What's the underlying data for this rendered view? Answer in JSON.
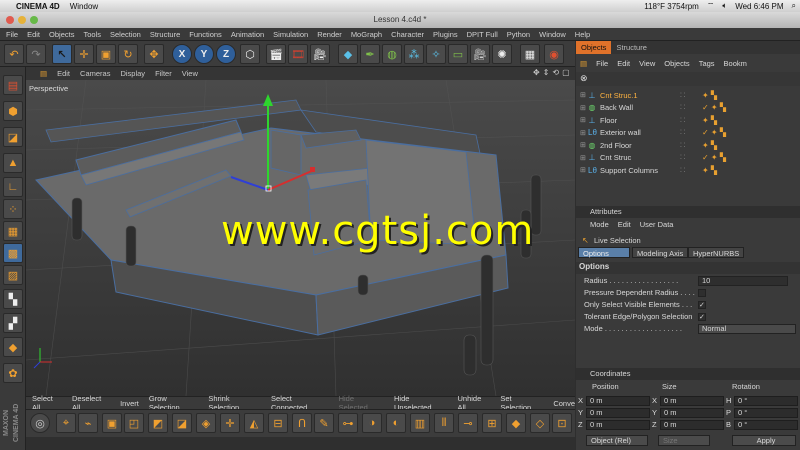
{
  "mac": {
    "app_name": "CINEMA 4D",
    "menu_window": "Window",
    "status": "118°F 3754rpm",
    "clock": "Wed 6:46 PM"
  },
  "window_title": "Lesson 4.c4d *",
  "menubar": [
    "File",
    "Edit",
    "Objects",
    "Tools",
    "Selection",
    "Structure",
    "Functions",
    "Animation",
    "Simulation",
    "Render",
    "MoGraph",
    "Character",
    "Plugins",
    "DPIT Full",
    "Python",
    "Window",
    "Help"
  ],
  "axis_buttons": [
    "X",
    "Y",
    "Z"
  ],
  "viewport": {
    "menu": [
      "Edit",
      "Cameras",
      "Display",
      "Filter",
      "View"
    ],
    "label": "Perspective",
    "watermark": "www.cgtsj.com"
  },
  "selection_bar": [
    {
      "label": "Select All",
      "enabled": true
    },
    {
      "label": "Deselect All",
      "enabled": true
    },
    {
      "label": "Invert",
      "enabled": true
    },
    {
      "label": "Grow Selection",
      "enabled": true
    },
    {
      "label": "Shrink Selection",
      "enabled": true
    },
    {
      "label": "Select Connected",
      "enabled": true
    },
    {
      "label": "Hide Selected",
      "enabled": false
    },
    {
      "label": "Hide Unselected",
      "enabled": true
    },
    {
      "label": "Unhide All",
      "enabled": true
    },
    {
      "label": "Set Selection",
      "enabled": true
    },
    {
      "label": "Conve",
      "enabled": true
    }
  ],
  "maxon_label": "MAXON CINEMA 4D",
  "object_manager": {
    "tabs": [
      "Objects",
      "Structure"
    ],
    "menu": [
      "File",
      "Edit",
      "View",
      "Objects",
      "Tags",
      "Bookm"
    ],
    "rows": [
      {
        "name": "Cnt Struc.1",
        "icon": "null",
        "highlighted": true
      },
      {
        "name": "Back Wall",
        "icon": "extrude",
        "highlighted": false
      },
      {
        "name": "Floor",
        "icon": "null",
        "highlighted": false
      },
      {
        "name": "Exterior wall",
        "icon": "bend",
        "highlighted": false
      },
      {
        "name": "2nd Floor",
        "icon": "extrude",
        "highlighted": false
      },
      {
        "name": "Cnt Struc",
        "icon": "null",
        "highlighted": false
      },
      {
        "name": "Support Columns",
        "icon": "bend",
        "highlighted": false
      }
    ]
  },
  "attributes": {
    "header": "Attributes",
    "menu": [
      "Mode",
      "Edit",
      "User Data"
    ],
    "title": "Live Selection",
    "tabs": [
      "Options",
      "Modeling Axis",
      "HyperNURBS"
    ],
    "section": "Options",
    "props": [
      {
        "label": "Radius . . . . . . . . . . . . . . . . .",
        "value": "10",
        "type": "field"
      },
      {
        "label": "Pressure Dependent Radius . . . .",
        "value": "",
        "type": "check"
      },
      {
        "label": "Only Select Visible Elements . . .",
        "value": "✓",
        "type": "check"
      },
      {
        "label": "Tolerant Edge/Polygon Selection",
        "value": "✓",
        "type": "check"
      },
      {
        "label": "Mode . . . . . . . . . . . . . . . . . . .",
        "value": "Normal",
        "type": "select"
      }
    ]
  },
  "coordinates": {
    "header": "Coordinates",
    "columns": [
      "Position",
      "Size",
      "Rotation"
    ],
    "rows": [
      {
        "axis": "X",
        "pos": "0 m",
        "size_axis": "X",
        "size": "0 m",
        "rot_axis": "H",
        "rot": "0 °"
      },
      {
        "axis": "Y",
        "pos": "0 m",
        "size_axis": "Y",
        "size": "0 m",
        "rot_axis": "P",
        "rot": "0 °"
      },
      {
        "axis": "Z",
        "pos": "0 m",
        "size_axis": "Z",
        "size": "0 m",
        "rot_axis": "B",
        "rot": "0 °"
      }
    ],
    "mode": "Object (Rel)",
    "size_mode": "Size",
    "apply": "Apply"
  }
}
